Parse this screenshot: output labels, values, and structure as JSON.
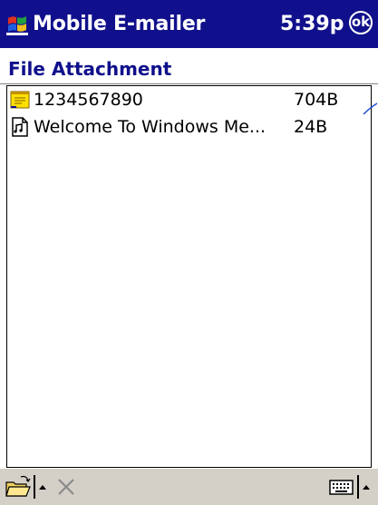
{
  "titlebar": {
    "app_title": "Mobile E-mailer",
    "time": "5:39p",
    "ok_label": "ok",
    "start_icon": "windows-flag-icon"
  },
  "page": {
    "title": "File Attachment"
  },
  "files": [
    {
      "name": "1234567890",
      "size": "704B",
      "icon": "message-note-icon"
    },
    {
      "name": "Welcome To Windows Me...",
      "size": "24B",
      "icon": "document-icon"
    }
  ],
  "command_bar": {
    "open_icon": "open-folder-icon",
    "menu_arrow_icon": "up-arrow-icon",
    "delete_icon": "delete-x-icon",
    "keyboard_icon": "keyboard-icon",
    "input_arrow_icon": "up-arrow-icon"
  },
  "colors": {
    "titlebar_bg": "#10108c",
    "title_text": "#10108c",
    "command_bar_bg": "#d4d0c8"
  }
}
